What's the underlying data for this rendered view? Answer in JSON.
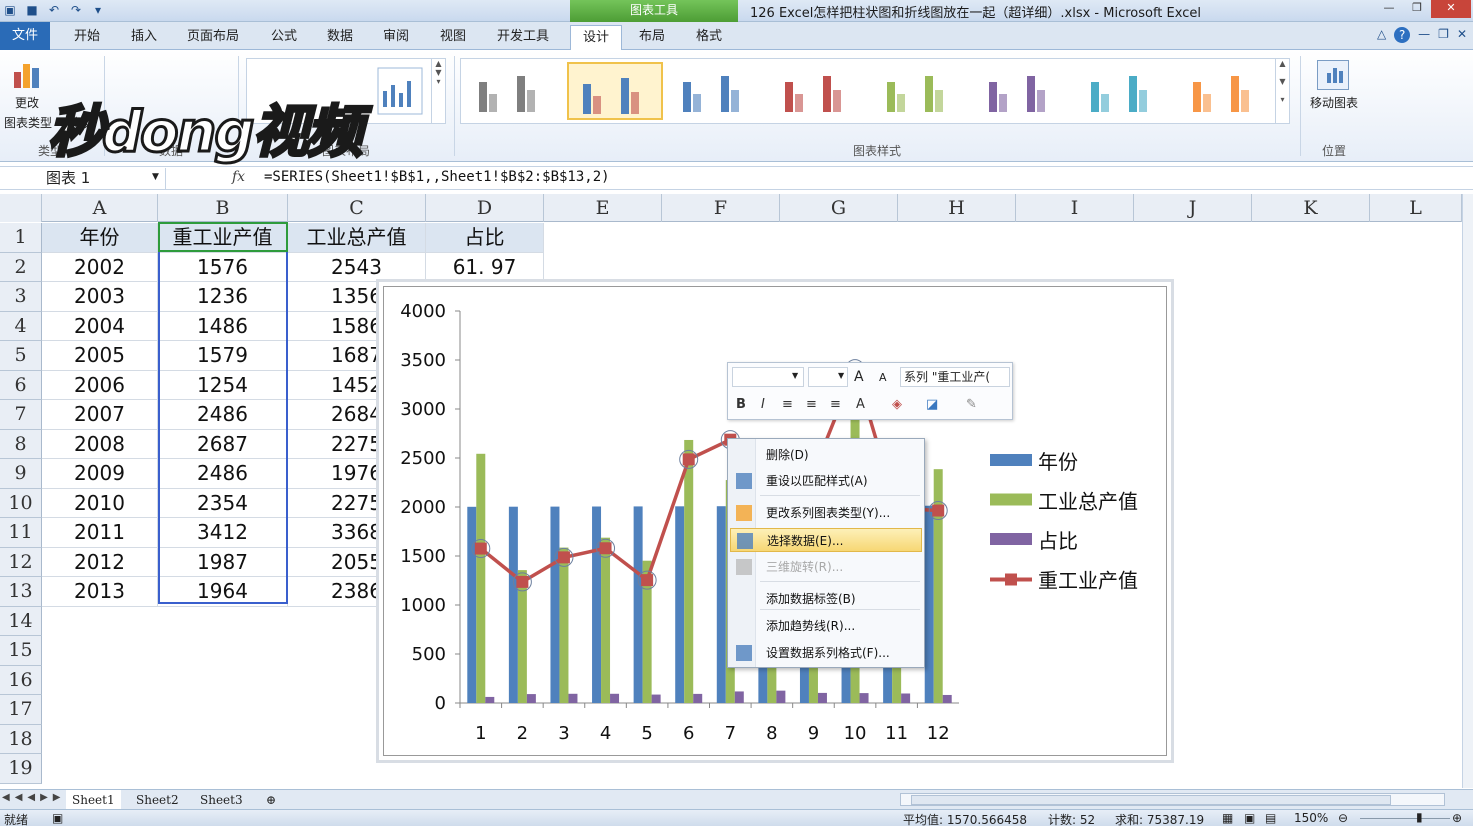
{
  "window": {
    "title": "126 Excel怎样把柱状图和折线图放在一起（超详细）.xlsx - Microsoft Excel",
    "chart_tools_label": "图表工具"
  },
  "tabs": [
    {
      "label": "文件"
    },
    {
      "label": "开始"
    },
    {
      "label": "插入"
    },
    {
      "label": "页面布局"
    },
    {
      "label": "公式"
    },
    {
      "label": "数据"
    },
    {
      "label": "审阅"
    },
    {
      "label": "视图"
    },
    {
      "label": "开发工具"
    },
    {
      "label": "设计"
    },
    {
      "label": "布局"
    },
    {
      "label": "格式"
    }
  ],
  "ribbon": {
    "change_type_line1": "更改",
    "change_type_line2": "图表类型",
    "template_label": "模板",
    "move_chart_label": "移动图表",
    "groups": {
      "type": "类型",
      "data": "数据",
      "layout": "图表布局",
      "styles": "图表样式",
      "location": "位置"
    },
    "watermark": "秒dong视频",
    "style_colors": [
      "#7f7f7f",
      "#4f81bd",
      "#4f81bd",
      "#c0504d",
      "#9bbb59",
      "#8064a2",
      "#4bacc6",
      "#f79646"
    ]
  },
  "formula_bar": {
    "name_box": "图表 1",
    "fx": "fx",
    "formula": "=SERIES(Sheet1!$B$1,,Sheet1!$B$2:$B$13,2)"
  },
  "columns": [
    "A",
    "B",
    "C",
    "D",
    "E",
    "F",
    "G",
    "H",
    "I",
    "J",
    "K",
    "L"
  ],
  "rows": [
    "1",
    "2",
    "3",
    "4",
    "5",
    "6",
    "7",
    "8",
    "9",
    "10",
    "11",
    "12",
    "13",
    "14",
    "15",
    "16",
    "17",
    "18",
    "19"
  ],
  "table": {
    "headers": [
      "年份",
      "重工业产值",
      "工业总产值",
      "占比"
    ],
    "data": [
      [
        "2002",
        "1576",
        "2543",
        "61. 97"
      ],
      [
        "2003",
        "1236",
        "1356",
        ""
      ],
      [
        "2004",
        "1486",
        "1586",
        ""
      ],
      [
        "2005",
        "1579",
        "1687",
        ""
      ],
      [
        "2006",
        "1254",
        "1452",
        ""
      ],
      [
        "2007",
        "2486",
        "2684",
        ""
      ],
      [
        "2008",
        "2687",
        "2275",
        ""
      ],
      [
        "2009",
        "2486",
        "1976",
        ""
      ],
      [
        "2010",
        "2354",
        "2275",
        ""
      ],
      [
        "2011",
        "3412",
        "3368",
        ""
      ],
      [
        "2012",
        "1987",
        "2055",
        ""
      ],
      [
        "2013",
        "1964",
        "2386",
        ""
      ]
    ]
  },
  "chart_data": {
    "type": "bar",
    "categories": [
      "1",
      "2",
      "3",
      "4",
      "5",
      "6",
      "7",
      "8",
      "9",
      "10",
      "11",
      "12"
    ],
    "ylim": [
      0,
      4000
    ],
    "yticks": [
      "4000",
      "3500",
      "3000",
      "2500",
      "2000",
      "1500",
      "1000",
      "500",
      "0"
    ],
    "series": [
      {
        "name": "年份",
        "kind": "bar",
        "color": "#4f81bd",
        "values": [
          2002,
          2003,
          2004,
          2005,
          2006,
          2007,
          2008,
          2009,
          2010,
          2011,
          2012,
          2013
        ]
      },
      {
        "name": "工业总产值",
        "kind": "bar",
        "color": "#9bbb59",
        "values": [
          2543,
          1356,
          1586,
          1687,
          1452,
          2684,
          2275,
          1976,
          2275,
          3368,
          2055,
          2386
        ]
      },
      {
        "name": "占比",
        "kind": "bar",
        "color": "#8064a2",
        "values": [
          61.97,
          91,
          94,
          94,
          86,
          93,
          118,
          126,
          103,
          101,
          97,
          82
        ]
      },
      {
        "name": "重工业产值",
        "kind": "line",
        "color": "#c0504d",
        "values": [
          1576,
          1236,
          1486,
          1579,
          1254,
          2486,
          2687,
          2486,
          2354,
          3412,
          1987,
          1964
        ]
      }
    ],
    "legend_position": "right"
  },
  "mini_toolbar": {
    "series_select": "系列 \"重工业产(",
    "grow_font": "A",
    "shrink_font": "A",
    "bold": "B",
    "italic": "I",
    "font_color": "A"
  },
  "context_menu": [
    {
      "label": "删除(D)",
      "state": "normal"
    },
    {
      "label": "重设以匹配样式(A)",
      "state": "normal"
    },
    {
      "label": "更改系列图表类型(Y)...",
      "state": "normal"
    },
    {
      "label": "选择数据(E)...",
      "state": "hover"
    },
    {
      "label": "三维旋转(R)...",
      "state": "disabled"
    },
    {
      "label": "添加数据标签(B)",
      "state": "normal"
    },
    {
      "label": "添加趋势线(R)...",
      "state": "normal"
    },
    {
      "label": "设置数据系列格式(F)...",
      "state": "normal"
    }
  ],
  "sheets": [
    "Sheet1",
    "Sheet2",
    "Sheet3"
  ],
  "status": {
    "ready": "就绪",
    "average": "平均值: 1570.566458",
    "count": "计数: 52",
    "sum": "求和: 75387.19",
    "zoom": "150%"
  }
}
